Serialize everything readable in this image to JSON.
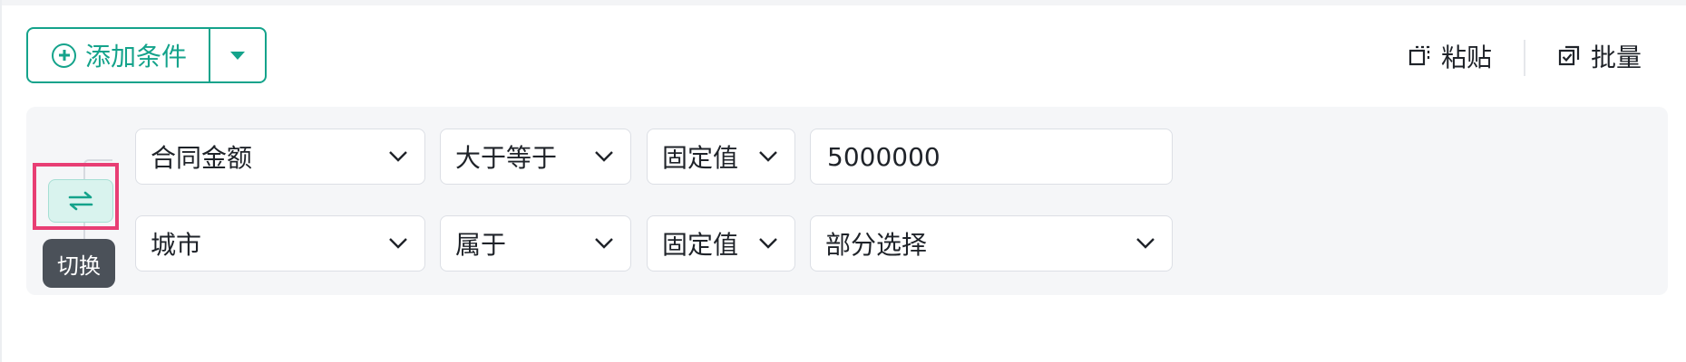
{
  "toolbar": {
    "add_label": "添加条件",
    "paste_label": "粘贴",
    "batch_label": "批量"
  },
  "switch": {
    "tooltip": "切换"
  },
  "conditions": [
    {
      "field": "合同金额",
      "operator": "大于等于",
      "value_type": "固定值",
      "value": "5000000"
    },
    {
      "field": "城市",
      "operator": "属于",
      "value_type": "固定值",
      "value": "部分选择"
    }
  ],
  "colors": {
    "accent": "#14a38b",
    "highlight": "#e83e74",
    "tooltip_bg": "#4b5159",
    "panel_bg": "#f5f6f8"
  },
  "icons": {
    "add": "plus-circle-icon",
    "dropdown": "caret-down-icon",
    "paste": "paste-icon",
    "batch": "batch-checkbox-icon",
    "switch": "swap-arrows-icon",
    "select_chevron": "chevron-down-icon"
  }
}
